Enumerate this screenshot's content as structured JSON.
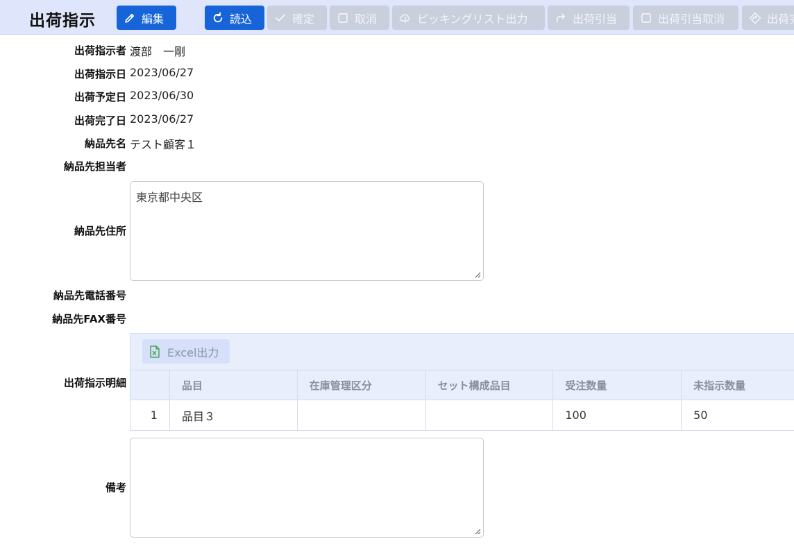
{
  "header": {
    "title": "出荷指示",
    "buttons": [
      {
        "label": "編集",
        "icon": "pencil-icon",
        "state": "primary"
      },
      {
        "label": "読込",
        "icon": "reload-icon",
        "state": "primary"
      },
      {
        "label": "確定",
        "icon": "check-icon",
        "state": "disabled"
      },
      {
        "label": "取消",
        "icon": "square-icon",
        "state": "disabled"
      },
      {
        "label": "ピッキングリスト出力",
        "icon": "cloud-download-icon",
        "state": "disabled"
      },
      {
        "label": "出荷引当",
        "icon": "redo-arrow-icon",
        "state": "disabled"
      },
      {
        "label": "出荷引当取消",
        "icon": "square-icon",
        "state": "disabled"
      },
      {
        "label": "出荷完",
        "icon": "diamond-arrow-icon",
        "state": "disabled"
      }
    ],
    "colors": {
      "bar": "#dfe6fb",
      "primary": "#1664d8",
      "disabled": "#c9cfdc"
    }
  },
  "form": {
    "instructor_label": "出荷指示者",
    "instructor_value": "渡部　一剛",
    "instruction_date_label": "出荷指示日",
    "instruction_date_value": "2023/06/27",
    "planned_date_label": "出荷予定日",
    "planned_date_value": "2023/06/30",
    "completed_date_label": "出荷完了日",
    "completed_date_value": "2023/06/27",
    "customer_label": "納品先名",
    "customer_value": "テスト顧客１",
    "contact_label": "納品先担当者",
    "address_label": "納品先住所",
    "address_value": "東京都中央区",
    "phone_label": "納品先電話番号",
    "fax_label": "納品先FAX番号",
    "details_label": "出荷指示明細",
    "notes_label": "備考",
    "notes_value": ""
  },
  "details": {
    "excel_button": "Excel出力",
    "columns": [
      "",
      "品目",
      "在庫管理区分",
      "セット構成品目",
      "受注数量",
      "未指示数量"
    ],
    "rows": [
      [
        "1",
        "品目３",
        "",
        "",
        "100",
        "50"
      ]
    ]
  }
}
